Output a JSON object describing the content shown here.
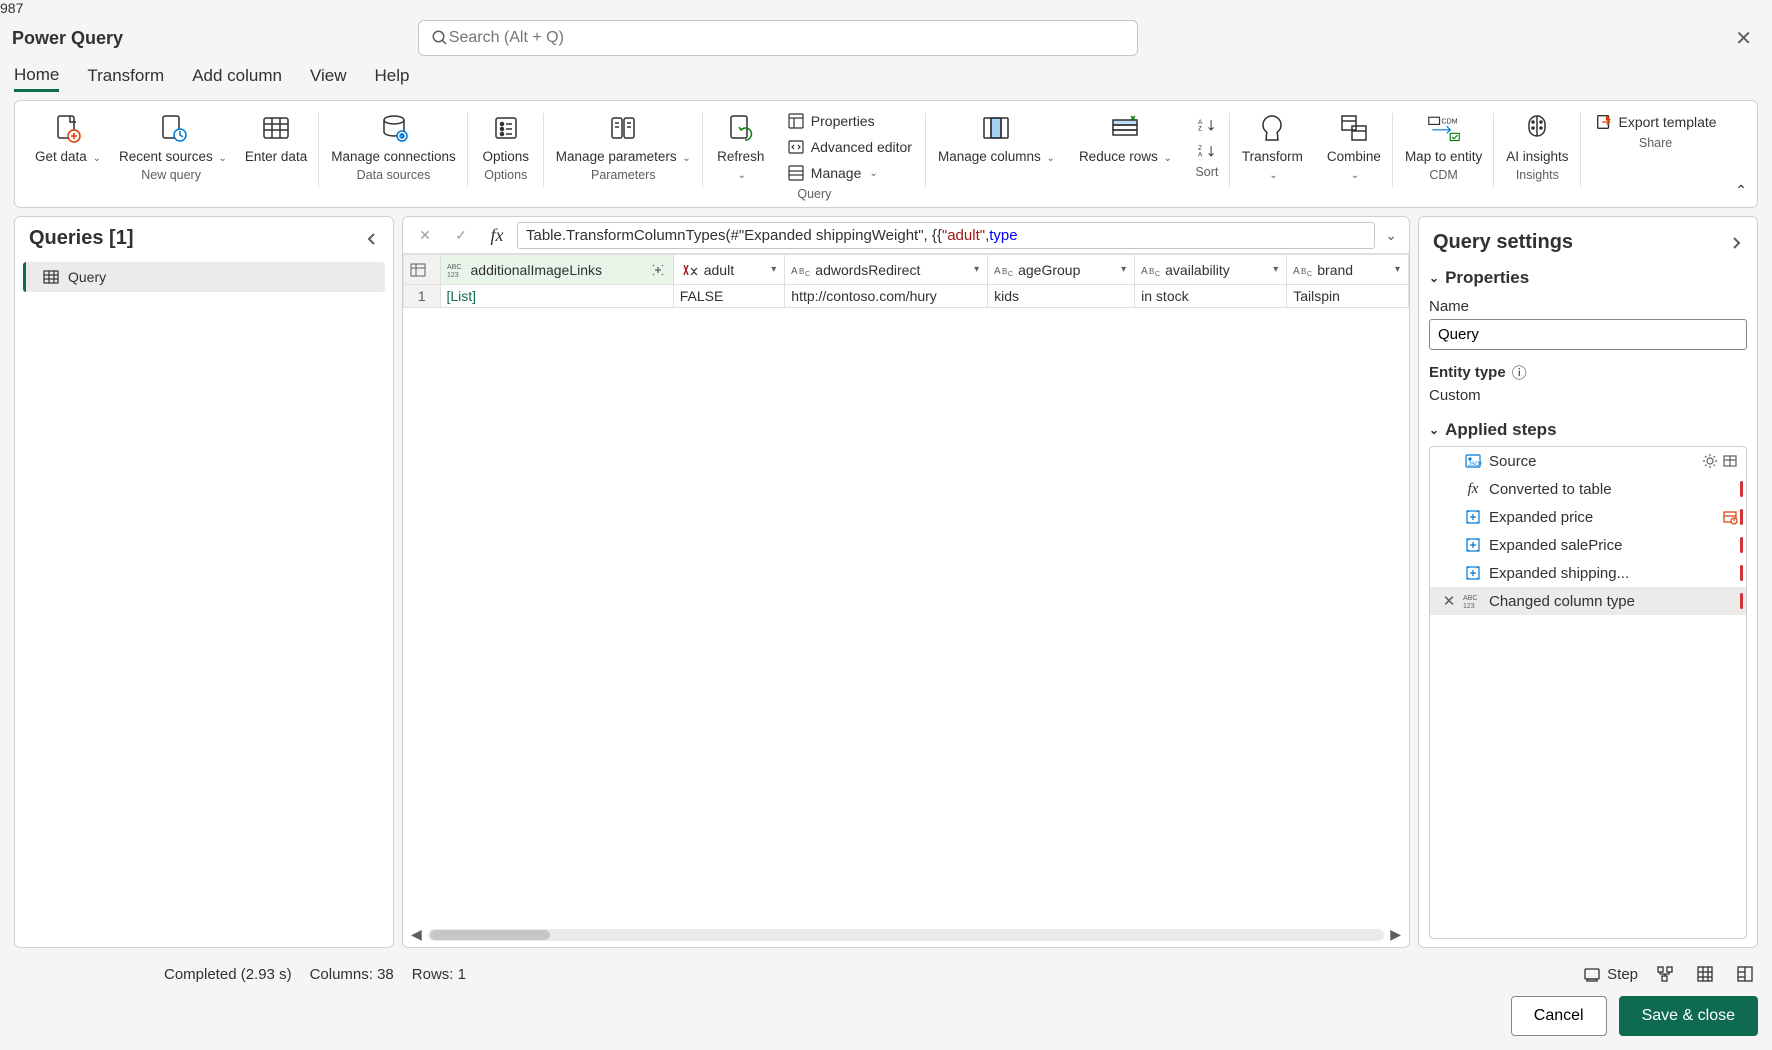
{
  "app": {
    "title": "Power Query"
  },
  "search": {
    "placeholder": "Search (Alt + Q)"
  },
  "tabs": [
    "Home",
    "Transform",
    "Add column",
    "View",
    "Help"
  ],
  "ribbon": {
    "get_data": "Get data",
    "recent_sources": "Recent sources",
    "enter_data": "Enter data",
    "manage_connections": "Manage connections",
    "options": "Options",
    "manage_parameters": "Manage parameters",
    "refresh": "Refresh",
    "properties": "Properties",
    "advanced_editor": "Advanced editor",
    "manage": "Manage",
    "manage_columns": "Manage columns",
    "reduce_rows": "Reduce rows",
    "transform": "Transform",
    "combine": "Combine",
    "map_to_entity": "Map to entity",
    "ai_insights": "AI insights",
    "export_template": "Export template",
    "groups": {
      "new_query": "New query",
      "data_sources": "Data sources",
      "options": "Options",
      "parameters": "Parameters",
      "query": "Query",
      "sort": "Sort",
      "cdm": "CDM",
      "insights": "Insights",
      "share": "Share"
    }
  },
  "queries_panel": {
    "title": "Queries [1]",
    "items": [
      "Query"
    ]
  },
  "formula": {
    "prefix": "Table.TransformColumnTypes(#\"Expanded shippingWeight\", {{",
    "str": "\"adult\"",
    "sep": ", ",
    "kw": "type"
  },
  "columns": [
    {
      "name": "additionalImageLinks",
      "type": "any",
      "expand": true
    },
    {
      "name": "adult",
      "type": "changed"
    },
    {
      "name": "adwordsRedirect",
      "type": "text"
    },
    {
      "name": "ageGroup",
      "type": "text"
    },
    {
      "name": "availability",
      "type": "text"
    },
    {
      "name": "brand",
      "type": "text"
    }
  ],
  "rows": [
    {
      "n": "1",
      "cells": [
        "[List]",
        "FALSE",
        "http://contoso.com/hury",
        "kids",
        "in stock",
        "Tailspin"
      ]
    }
  ],
  "settings": {
    "title": "Query settings",
    "properties_label": "Properties",
    "name_label": "Name",
    "name_value": "Query",
    "entity_type_label": "Entity type",
    "entity_type_value": "Custom",
    "applied_steps_label": "Applied steps",
    "steps": [
      {
        "label": "Source",
        "icon": "source",
        "gear": true
      },
      {
        "label": "Converted to table",
        "icon": "fx"
      },
      {
        "label": "Expanded price",
        "icon": "expand",
        "marker": true,
        "warn": true
      },
      {
        "label": "Expanded salePrice",
        "icon": "expand",
        "marker": true
      },
      {
        "label": "Expanded shipping...",
        "icon": "expand",
        "marker": true
      },
      {
        "label": "Changed column type",
        "icon": "type",
        "marker": true,
        "deletable": true,
        "selected": true
      }
    ]
  },
  "status": {
    "completed": "Completed (2.93 s)",
    "columns": "Columns: 38",
    "rows": "Rows: 1",
    "step": "Step"
  },
  "footer": {
    "cancel": "Cancel",
    "save_close": "Save & close"
  }
}
